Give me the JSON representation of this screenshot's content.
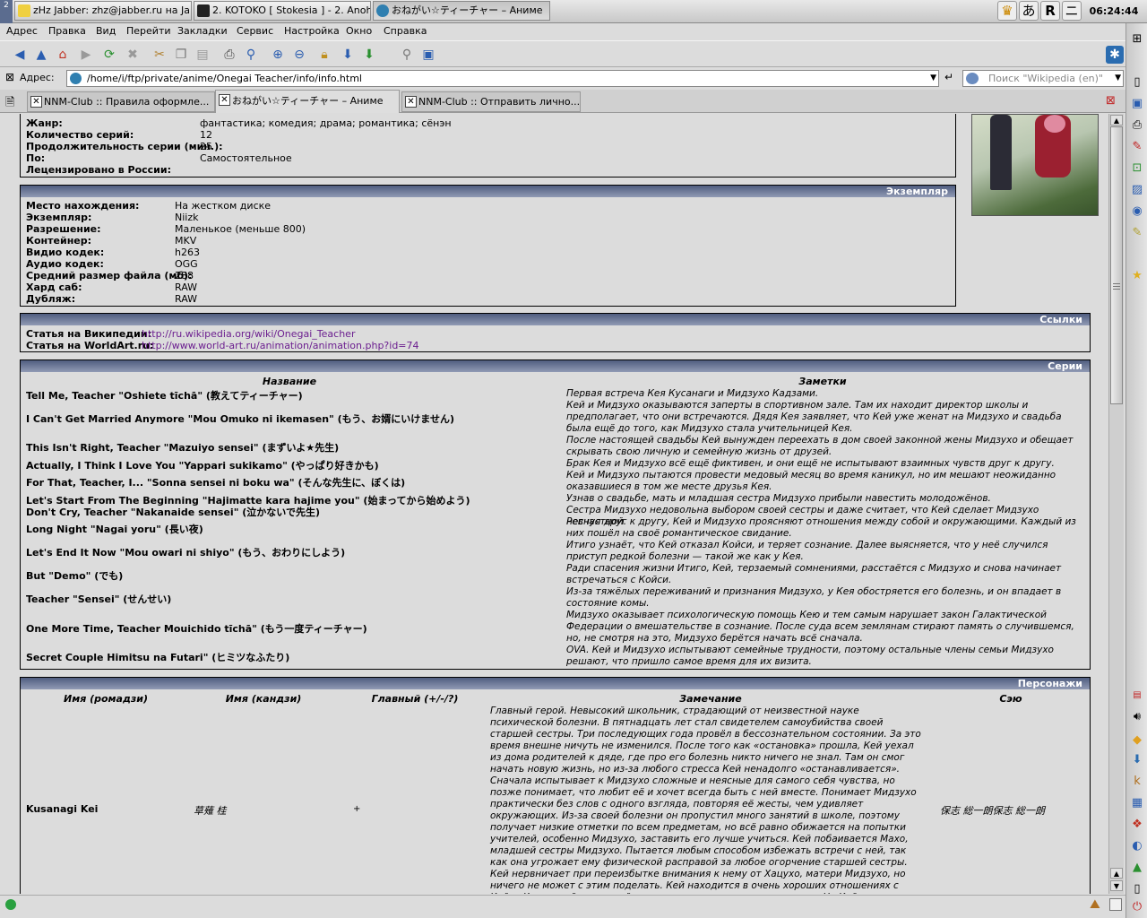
{
  "taskbar": {
    "desktop_label": "2",
    "tasks": [
      {
        "label": "zHz Jabber: zhz@jabber.ru на Jabber.ru",
        "active": false
      },
      {
        "label": "2. KOTOKO [ Stokesia ] - 2. Anohi Nani",
        "active": false
      },
      {
        "label": "おねがい☆ティーチャー – Аниме",
        "active": true
      }
    ],
    "tray": [
      "♛",
      "あ",
      "R",
      "ニ"
    ],
    "clock": "06:24:44 pm"
  },
  "menu": [
    "Адрес",
    "Правка",
    "Вид",
    "Перейти",
    "Закладки",
    "Сервис",
    "Настройка",
    "Окно",
    "Справка"
  ],
  "address": {
    "label": "Адрес:",
    "url": "/home/i/ftp/private/anime/Onegai Teacher/info/info.html",
    "search_placeholder": "Поиск \"Wikipedia (en)\""
  },
  "tabs": [
    {
      "label": "NNM-Club :: Правила оформле...",
      "active": false
    },
    {
      "label": "おねがい☆ティーチャー – Аниме",
      "active": true
    },
    {
      "label": "NNM-Club :: Отправить лично...",
      "active": false
    }
  ],
  "info_top": {
    "rows": [
      {
        "k": "Жанр:",
        "v": "фантастика; комедия; драма; романтика; сёнэн"
      },
      {
        "k": "Количество серий:",
        "v": "12"
      },
      {
        "k": "Продолжительность серии (мин.):",
        "v": "25"
      },
      {
        "k": "По:",
        "v": "Самостоятельное"
      },
      {
        "k": "Лецензировано в России:",
        "v": ""
      }
    ]
  },
  "copy_box": {
    "title": "Экземпляр",
    "rows": [
      {
        "k": "Место нахождения:",
        "v": "На жестком диске"
      },
      {
        "k": "Экземпляр:",
        "v": "Niizk"
      },
      {
        "k": "Разрешение:",
        "v": "Маленькое (меньше 800)"
      },
      {
        "k": "Контейнер:",
        "v": "MKV"
      },
      {
        "k": "Видио кодек:",
        "v": "h263"
      },
      {
        "k": "Аудио кодек:",
        "v": "OGG"
      },
      {
        "k": "Средний размер файла (мб):",
        "v": "288"
      },
      {
        "k": "Хард саб:",
        "v": "RAW"
      },
      {
        "k": "Дубляж:",
        "v": "RAW"
      }
    ]
  },
  "links_box": {
    "title": "Ссылки",
    "rows": [
      {
        "k": "Статья на Википедии:",
        "v": "http://ru.wikipedia.org/wiki/Onegai_Teacher"
      },
      {
        "k": "Статья на WorldArt.ru:",
        "v": "http://www.world-art.ru/animation/animation.php?id=74"
      }
    ]
  },
  "episodes_box": {
    "title": "Серии",
    "col_name": "Название",
    "col_notes": "Заметки",
    "rows": [
      {
        "name": "Tell Me, Teacher \"Oshiete tīchā\" (教えてティーチャー)",
        "note": "Первая встреча Кея Кусанаги и Мидзухо Кадзами."
      },
      {
        "name": "I Can't Get Married Anymore \"Mou Omuko ni ikemasen\" (もう、お婿にいけません)",
        "note": "Кей и Мидзухо оказываются заперты в спортивном зале. Там их находит директор школы и предполагает, что они встречаются. Дядя Кея заявляет, что Кей уже женат на Мидзухо и свадьба была ещё до того, как Мидзухо стала учительницей Кея."
      },
      {
        "name": "This Isn't Right, Teacher \"Mazuiyo sensei\" (まずいよ★先生)",
        "note": "После настоящей свадьбы Кей вынужден переехать в дом своей законной жены Мидзухо и обещает скрывать свою личную и семейную жизнь от друзей."
      },
      {
        "name": "Actually, I Think I Love You \"Yappari sukikamo\" (やっぱり好きかも)",
        "note": "Брак Кея и Мидзухо всё ещё фиктивен, и они ещё не испытывают взаимных чувств друг к другу."
      },
      {
        "name": "For That, Teacher, I... \"Sonna sensei ni boku wa\" (そんな先生に、ぼくは)",
        "note": "Кей и Мидзухо пытаются провести медовый месяц во время каникул, но им мешают неожиданно оказавшиеся в том же месте друзья Кея."
      },
      {
        "name": "Let's Start From The Beginning \"Hajimatte kara hajime you\" (始まってから始めよう)",
        "note": "Узнав о свадьбе, мать и младшая сестра Мидзухо прибыли навестить молодожёнов."
      },
      {
        "name": "Don't Cry, Teacher \"Nakanaide sensei\" (泣かないで先生)",
        "note": "Сестра Мидзухо недовольна выбором своей сестры и даже считает, что Кей сделает Мидзухо несчастной."
      },
      {
        "name": "Long Night \"Nagai yoru\" (長い夜)",
        "note": "Ревнуя друг к другу, Кей и Мидзухо проясняют отношения между собой и окружающими. Каждый из них пошёл на своё романтическое свидание."
      },
      {
        "name": "Let's End It Now \"Mou owari ni shiyo\" (もう、おわりにしよう)",
        "note": "Итиго узнаёт, что Кей отказал Койси, и теряет сознание. Далее выясняется, что у неё случился приступ редкой болезни — такой же как у Кея."
      },
      {
        "name": "But \"Demo\" (でも)",
        "note": "Ради спасения жизни Итиго, Кей, терзаемый сомнениями, расстаётся с Мидзухо и снова начинает встречаться с Койси."
      },
      {
        "name": "Teacher \"Sensei\" (せんせい)",
        "note": "Из-за тяжёлых переживаний и признания Мидзухо, у Кея обостряется его болезнь, и он впадает в состояние комы."
      },
      {
        "name": "One More Time, Teacher Mouichido tīchā\" (もう一度ティーチャー)",
        "note": "Мидзухо оказывает психологическую помощь Кею и тем самым нарушает закон Галактической Федерации о вмешательстве в сознание. После суда всем землянам стирают память о случившемся, но, не смотря на это, Мидзухо берётся начать всё сначала."
      },
      {
        "name": "Secret Couple Himitsu na Futari\" (ヒミツなふたり)",
        "note": "OVA. Кей и Мидзухо испытывают семейные трудности, поэтому остальные члены семьи Мидзухо решают, что пришло самое время для их визита."
      }
    ]
  },
  "chars_box": {
    "title": "Персонажи",
    "cols": [
      "Имя (ромадзи)",
      "Имя (кандзи)",
      "Главный (+/-/?)",
      "Замечание",
      "Сэю"
    ],
    "row": {
      "romaji": "Kusanagi Kei",
      "kanji": "草薙 桂",
      "main": "+",
      "note": "Главный герой. Невысокий школьник, страдающий от неизвестной науке психической болезни. В пятнадцать лет стал свидетелем самоубийства своей старшей сестры. Три последующих года провёл в бессознательном состоянии. За это время внешне ничуть не изменился. После того как «остановка» прошла, Кей уехал из дома родителей к дяде, где про его болезнь никто ничего не знал. Там он смог начать новую жизнь, но из-за любого стресса Кей ненадолго «останавливается». Сначала испытывает к Мидзухо сложные и неясные для самого себя чувства, но позже понимает, что любит её и хочет всегда быть с ней вместе. Понимает Мидзухо практически без слов с одного взгляда, повторяя её жесты, чем удивляет окружающих. Из-за своей болезни он пропустил много занятий в школе, поэтому получает низкие отметки по всем предметам, но всё равно обижается на попытки учителей, особенно Мидзухо, заставить его лучше учиться. Кей побаивается Махо, младшей сестры Мидзухо. Пытается любым способом избежать встречи с ней, так как она угрожает ему физической расправой за любое огорчение старшей сестры. Кей нервничает при переизбытке внимания к нему от Хацухо, матери Мидзухо, но ничего не может с этим поделать. Кей находится в очень хороших отношениях с Койси Херикавой, с которой он иногда встречается после школы. Но Кей не испытывает к ней никаких чувств и старается не",
      "seiyu": "保志 総一朗保志 総一朗"
    }
  }
}
